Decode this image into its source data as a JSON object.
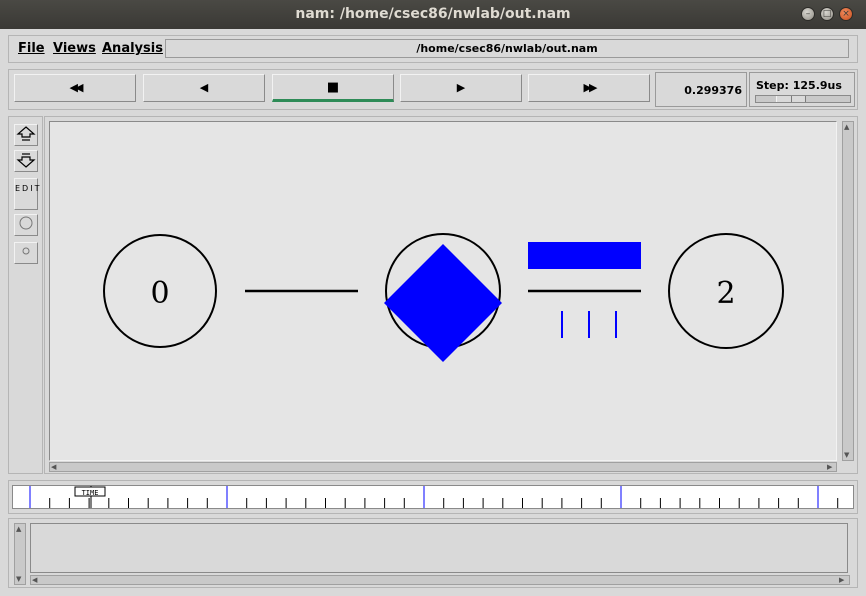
{
  "window": {
    "title": "nam: /home/csec86/nwlab/out.nam"
  },
  "menubar": {
    "items": [
      {
        "label": "File"
      },
      {
        "label": "Views"
      },
      {
        "label": "Analysis"
      }
    ],
    "path": "/home/csec86/nwlab/out.nam"
  },
  "playback": {
    "rewind_glyph": "◀◀",
    "back_glyph": "◀",
    "stop_glyph": "■",
    "play_glyph": "▶",
    "fastforward_glyph": "▶▶",
    "active_button": "stop",
    "active_color": "#2e8b57",
    "current_time": "0.299376",
    "step_label": "Step: 125.9us"
  },
  "toolbar": {
    "edit_label": "EDIT"
  },
  "topology": {
    "nodes": [
      {
        "label": "0"
      },
      {
        "label": ""
      },
      {
        "label": "2"
      }
    ],
    "packet_color": "#0000ff"
  },
  "timeline": {
    "marker_label": "TIME"
  }
}
